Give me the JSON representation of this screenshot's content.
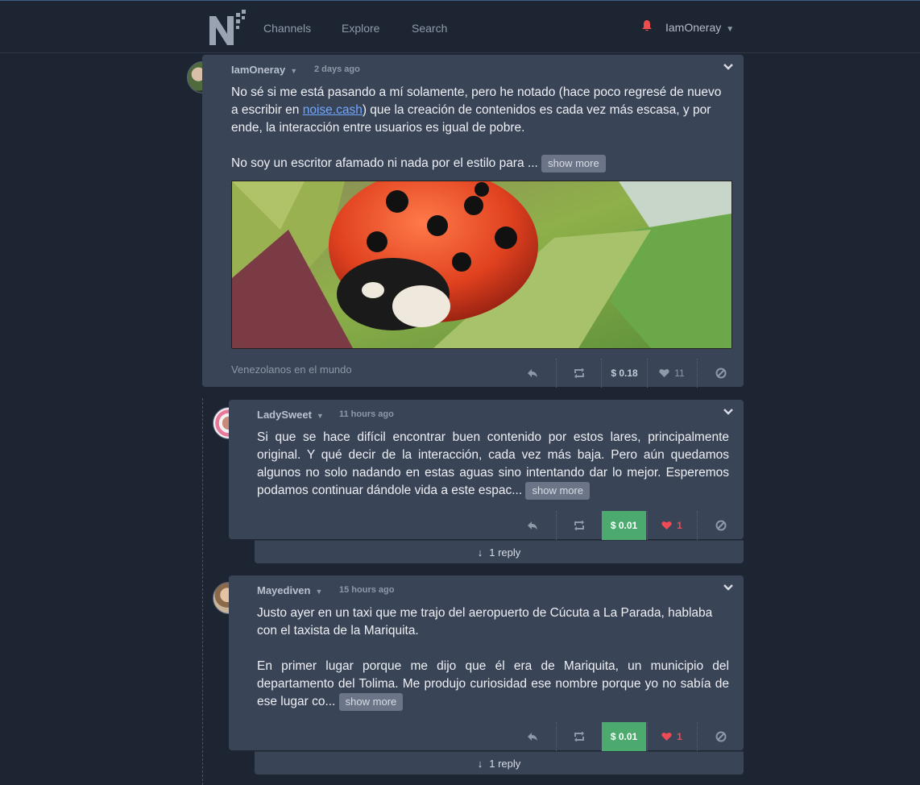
{
  "nav": {
    "links": [
      "Channels",
      "Explore",
      "Search"
    ],
    "username": "IamOneray",
    "colors": {
      "accent": "#6fa8ff",
      "bell": "#ef4d4d",
      "tip": "#4daa6f",
      "heart": "#ef4b57"
    }
  },
  "post": {
    "author": "IamOneray",
    "time": "2 days ago",
    "paragraph1_before_link": "No sé si me está pasando a mí solamente, pero he notado (hace poco regresé de nuevo a escribir en ",
    "link_text": "noise.cash",
    "paragraph1_after_link": ") que la creación de contenidos es cada vez más escasa, y por ende, la interacción entre usuarios es igual de pobre.",
    "paragraph2": "No soy un escritor afamado ni nada por el estilo para ...",
    "show_more": "show more",
    "community": "Venezolanos en el mundo",
    "tip_amount": "$ 0.18",
    "likes": "11"
  },
  "comments": [
    {
      "author": "LadySweet",
      "time": "11 hours ago",
      "text": "Si que se hace difícil encontrar buen contenido por estos lares, principalmente original. Y qué decir de la interacción, cada vez más baja. Pero aún quedamos algunos no solo nadando en estas aguas sino intentando dar lo mejor. Esperemos podamos continuar dándole vida a este espac...",
      "show_more": "show more",
      "tip_amount": "$ 0.01",
      "likes": "1",
      "replies": "1 reply"
    },
    {
      "author": "Mayediven",
      "time": "15 hours ago",
      "paragraph1": "Justo ayer en un taxi que me trajo del aeropuerto de Cúcuta a La Parada, hablaba con el taxista de la Mariquita.",
      "paragraph2": "En primer lugar porque me dijo que él era de Mariquita, un municipio del departamento del Tolima. Me produjo curiosidad ese nombre porque yo no sabía de ese lugar co...",
      "show_more": "show more",
      "tip_amount": "$ 0.01",
      "likes": "1",
      "replies": "1 reply"
    }
  ]
}
